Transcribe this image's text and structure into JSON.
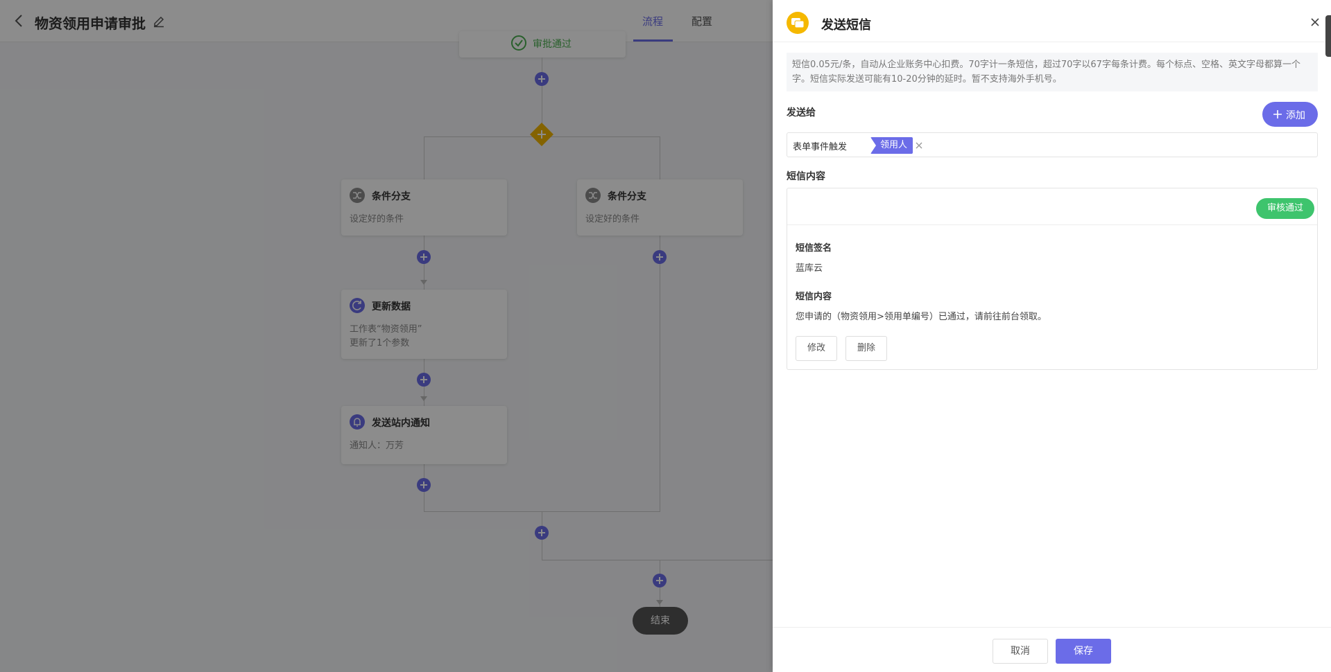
{
  "header": {
    "title": "物资领用申请审批",
    "tabs": [
      {
        "label": "流程",
        "active": true
      },
      {
        "label": "配置",
        "active": false
      }
    ]
  },
  "flow": {
    "approve_node": {
      "label": "审批通过"
    },
    "branches": [
      {
        "title": "条件分支",
        "desc": "设定好的条件"
      },
      {
        "title": "条件分支",
        "desc": "设定好的条件"
      }
    ],
    "update_node": {
      "title": "更新数据",
      "desc_line1": "工作表“物资领用”",
      "desc_line2": "更新了1个参数"
    },
    "notify_node": {
      "title": "发送站内通知",
      "desc": "通知人：万芳"
    },
    "end_node": {
      "label": "结束"
    }
  },
  "drawer": {
    "title": "发送短信",
    "notice": "短信0.05元/条，自动从企业账务中心扣费。70字计一条短信，超过70字以67字每条计费。每个标点、空格、英文字母都算一个字。短信实际发送可能有10-20分钟的延时。暂不支持海外手机号。",
    "send_to_label": "发送给",
    "add_button": "添加",
    "recipient": {
      "source": "表单事件触发",
      "target": "领用人"
    },
    "content_label": "短信内容",
    "status_badge": "审核通过",
    "signature_label": "短信签名",
    "signature_value": "蓝库云",
    "body_label": "短信内容",
    "body_value": "您申请的（物资领用>领用单编号）已通过，请前往前台领取。",
    "edit_button": "修改",
    "delete_button": "删除",
    "cancel_button": "取消",
    "save_button": "保存"
  },
  "colors": {
    "accent": "#6b6ce8",
    "success": "#3ec46d",
    "sms_icon": "#f5b800",
    "gateway": "#f0b400"
  },
  "icons": [
    "back-icon",
    "edit-title-icon",
    "check-circle-icon",
    "gateway-plus-icon",
    "shuffle-icon",
    "refresh-icon",
    "bell-icon",
    "chat-bubbles-icon",
    "close-icon",
    "plus-icon",
    "remove-tag-icon"
  ]
}
